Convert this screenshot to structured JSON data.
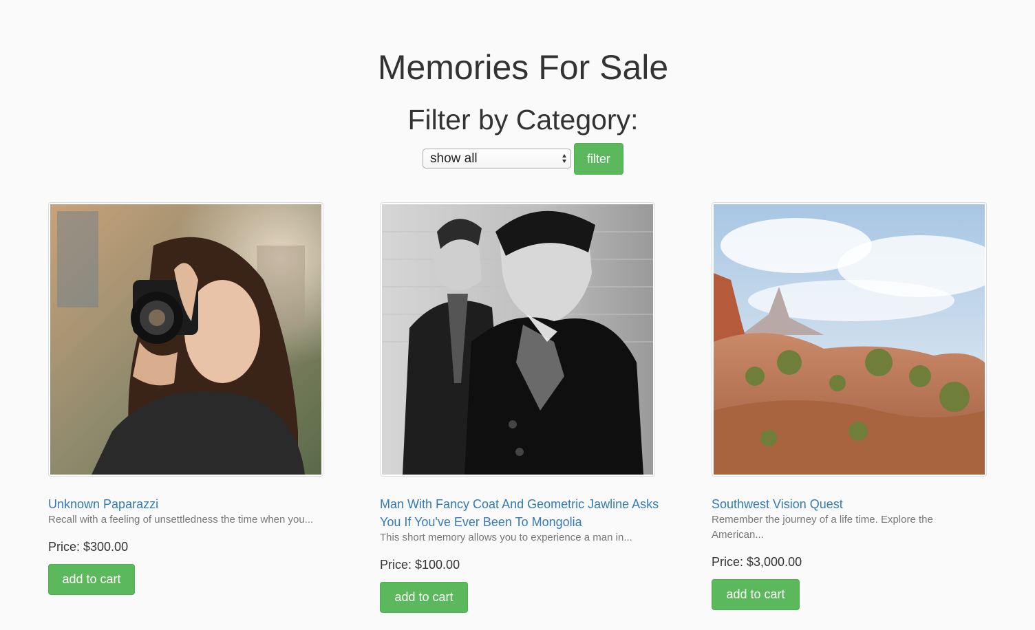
{
  "page": {
    "title": "Memories For Sale",
    "filter_heading": "Filter by Category:",
    "filter": {
      "selected": "show all",
      "button_label": "filter"
    }
  },
  "products": [
    {
      "title": "Unknown Paparazzi",
      "description": "Recall with a feeling of unsettledness the time when you...",
      "price": "Price: $300.00",
      "button_label": "add to cart"
    },
    {
      "title": "Man With Fancy Coat And Geometric Jawline Asks You If You've Ever Been To Mongolia",
      "description": "This short memory allows you to experience a man in...",
      "price": "Price: $100.00",
      "button_label": "add to cart"
    },
    {
      "title": "Southwest Vision Quest",
      "description": "Remember the journey of a life time. Explore the American...",
      "price": "Price: $3,000.00",
      "button_label": "add to cart"
    }
  ],
  "colors": {
    "link": "#337ab7",
    "success": "#5cb85c",
    "text": "#333333",
    "muted": "#777777"
  }
}
